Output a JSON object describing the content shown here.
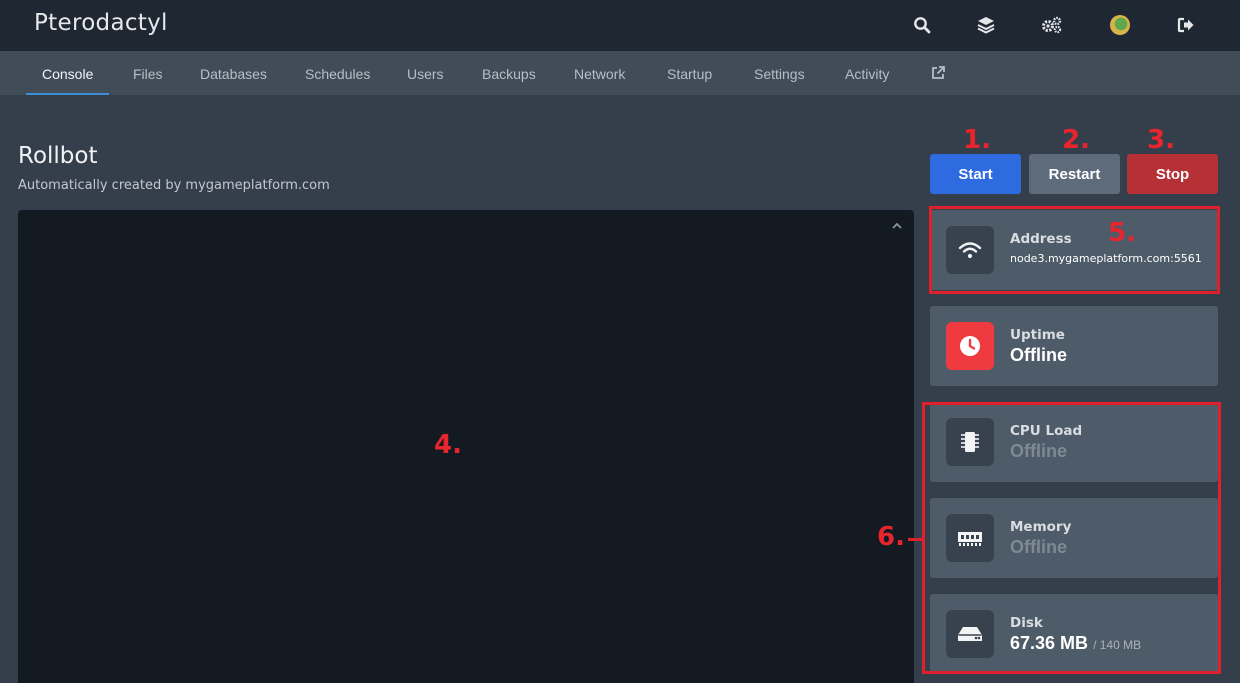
{
  "app": {
    "title": "Pterodactyl"
  },
  "top_icons": [
    "search-icon",
    "layers-icon",
    "cogs-icon",
    "avatar",
    "sign-out-icon"
  ],
  "nav": {
    "tabs": [
      {
        "label": "Console",
        "active": true
      },
      {
        "label": "Files"
      },
      {
        "label": "Databases"
      },
      {
        "label": "Schedules"
      },
      {
        "label": "Users"
      },
      {
        "label": "Backups"
      },
      {
        "label": "Network"
      },
      {
        "label": "Startup"
      },
      {
        "label": "Settings"
      },
      {
        "label": "Activity"
      }
    ],
    "external_icon": "external-link-icon"
  },
  "server": {
    "name": "Rollbot",
    "description": "Automatically created by mygameplatform.com"
  },
  "power": {
    "start": "Start",
    "restart": "Restart",
    "stop": "Stop"
  },
  "stats": {
    "address": {
      "label": "Address",
      "value": "node3.mygameplatform.com:5561",
      "icon": "wifi-icon"
    },
    "uptime": {
      "label": "Uptime",
      "value": "Offline",
      "icon": "clock-icon"
    },
    "cpu": {
      "label": "CPU Load",
      "value": "Offline",
      "icon": "microchip-icon"
    },
    "memory": {
      "label": "Memory",
      "value": "Offline",
      "icon": "memory-icon"
    },
    "disk": {
      "label": "Disk",
      "value": "67.36 MB",
      "limit": "/ 140 MB",
      "icon": "hdd-icon"
    }
  },
  "annotations": [
    "1.",
    "2.",
    "3.",
    "4.",
    "5.",
    "6."
  ],
  "colors": {
    "accent": "#3c8fd6",
    "start": "#2f6be0",
    "restart": "#5e6b7a",
    "stop": "#b53136",
    "uptime_icon": "#ef3b3f",
    "annotation": "#e0202a"
  }
}
